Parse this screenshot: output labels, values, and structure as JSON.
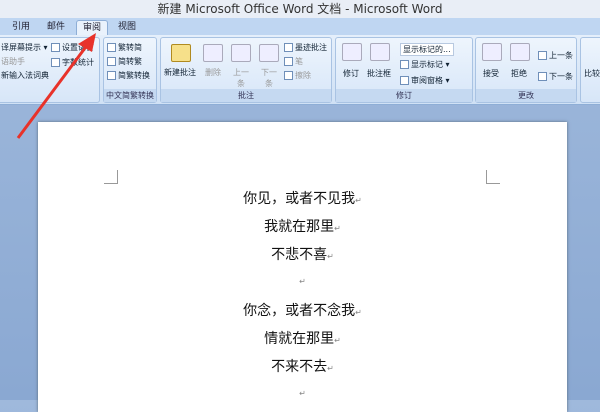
{
  "window_title": "新建 Microsoft Office Word 文档 - Microsoft Word",
  "tabs": [
    "引用",
    "邮件",
    "审阅",
    "视图"
  ],
  "active_tab": "审阅",
  "groups": {
    "proofing": {
      "items": [
        "译屏幕提示 ▾",
        "语助手",
        "新输入法词典",
        "设置语言",
        "字数统计"
      ]
    },
    "chinese": {
      "label": "中文简繁转换",
      "items": [
        "繁转简",
        "简转繁",
        "简繁转换"
      ]
    },
    "comments": {
      "label": "批注",
      "new": "新建批注",
      "delete": "删除",
      "prev": "上一条",
      "next": "下一条",
      "ink": "墨迹批注",
      "pen": "笔",
      "erase": "擦除"
    },
    "tracking": {
      "label": "修订",
      "track": "修订",
      "balloons": "批注框",
      "display": "显示标记的...",
      "show_markup": "显示标记 ▾",
      "pane": "审阅窗格 ▾"
    },
    "changes": {
      "label": "更改",
      "accept": "接受",
      "reject": "拒绝",
      "prev": "上一条",
      "next": "下一条"
    },
    "compare": {
      "label": "比较"
    }
  },
  "document": {
    "lines": [
      "你见，或者不见我",
      "我就在那里",
      "不悲不喜",
      "",
      "你念，或者不念我",
      "情就在那里",
      "不来不去",
      ""
    ],
    "return_mark": "↵"
  },
  "colors": {
    "arrow": "#e8322a"
  }
}
